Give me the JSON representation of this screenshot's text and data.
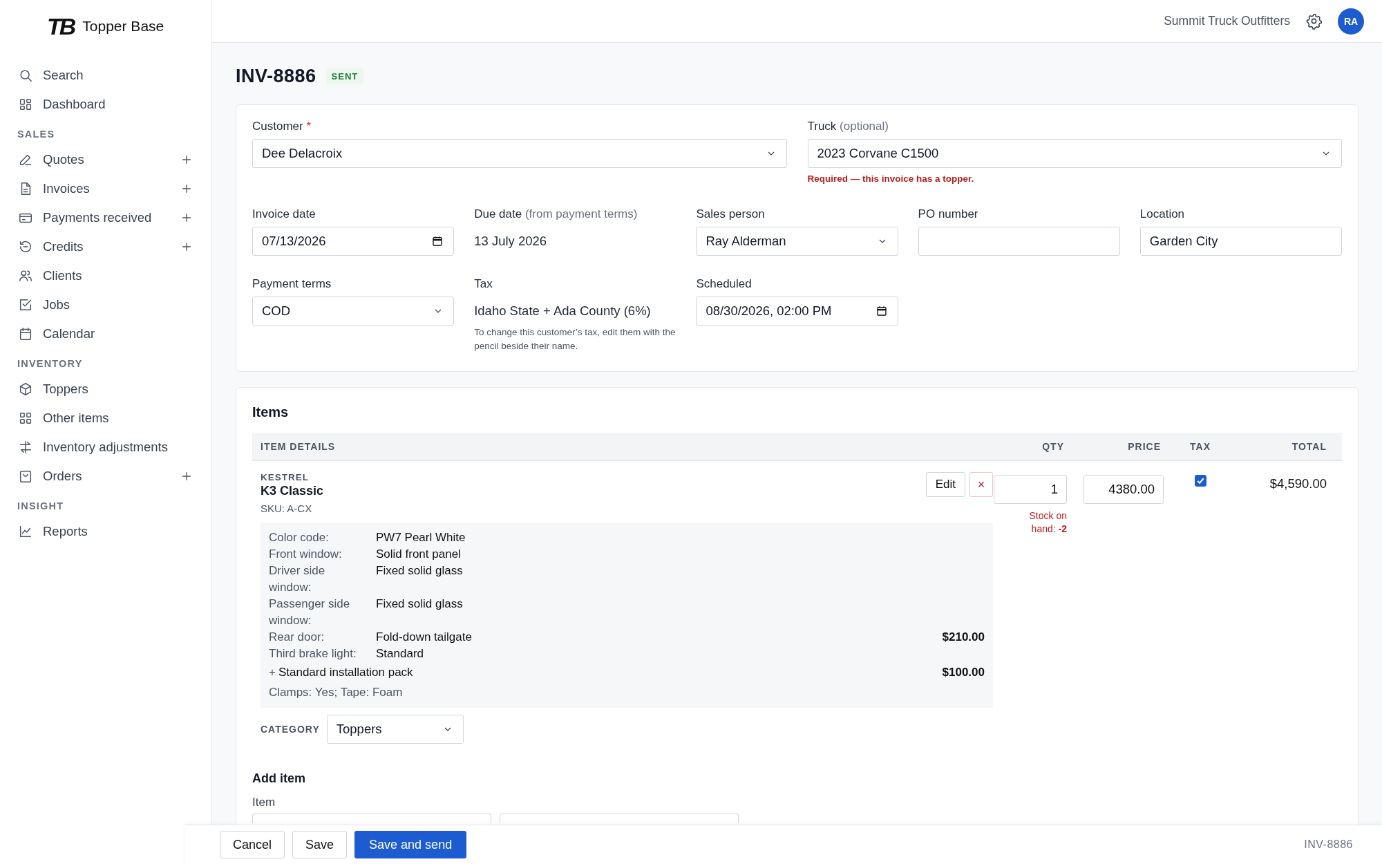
{
  "app": {
    "logo": "TB",
    "name": "Topper Base"
  },
  "sidebar": {
    "items": [
      {
        "kind": "link",
        "label": "Search",
        "add_button": false
      },
      {
        "kind": "link",
        "label": "Dashboard",
        "add_button": false
      },
      {
        "kind": "heading",
        "label": "SALES"
      },
      {
        "kind": "link",
        "label": "Quotes",
        "add_button": true
      },
      {
        "kind": "link",
        "label": "Invoices",
        "add_button": true
      },
      {
        "kind": "link",
        "label": "Payments received",
        "add_button": true
      },
      {
        "kind": "link",
        "label": "Credits",
        "add_button": true
      },
      {
        "kind": "link",
        "label": "Clients",
        "add_button": false
      },
      {
        "kind": "link",
        "label": "Jobs",
        "add_button": false
      },
      {
        "kind": "link",
        "label": "Calendar",
        "add_button": false
      },
      {
        "kind": "heading",
        "label": "INVENTORY"
      },
      {
        "kind": "link",
        "label": "Toppers",
        "add_button": false
      },
      {
        "kind": "link",
        "label": "Other items",
        "add_button": false
      },
      {
        "kind": "link",
        "label": "Inventory adjustments",
        "add_button": false
      },
      {
        "kind": "link",
        "label": "Orders",
        "add_button": true
      },
      {
        "kind": "heading",
        "label": "INSIGHT"
      },
      {
        "kind": "link",
        "label": "Reports",
        "add_button": false
      }
    ]
  },
  "header": {
    "company": "Summit Truck Outfitters",
    "avatar": "RA"
  },
  "invoice": {
    "number": "INV-8886",
    "status": "SENT"
  },
  "form": {
    "rows": [
      {
        "fields": [
          {
            "kind": "select",
            "label": "Customer",
            "required_mark": "*",
            "value": "Dee Delacroix"
          },
          {
            "kind": "select",
            "label": "Truck",
            "hint": "(optional)",
            "value": "2023 Corvane C1500",
            "error": "Required — this invoice has a topper."
          }
        ]
      },
      {
        "fields": [
          {
            "kind": "date",
            "label": "Invoice date",
            "value": "07/13/2026"
          },
          {
            "kind": "static",
            "label": "Due date",
            "hint": "(from payment terms)",
            "value": "13 July 2026"
          },
          {
            "kind": "select",
            "label": "Sales person",
            "value": "Ray Alderman"
          },
          {
            "kind": "text",
            "label": "PO number"
          },
          {
            "kind": "text",
            "label": "Location",
            "value": "Garden City"
          }
        ]
      },
      {
        "fields": [
          {
            "kind": "select",
            "label": "Payment terms",
            "value": "COD"
          },
          {
            "kind": "static",
            "label": "Tax",
            "value": "Idaho State + Ada County (6%)",
            "note": "To change this customer’s tax, edit them with the pencil beside their name."
          },
          {
            "kind": "date",
            "label": "Scheduled",
            "value": "08/30/2026, 02:00 PM"
          }
        ]
      }
    ]
  },
  "items": {
    "title": "Items",
    "columns": [
      "ITEM DETAILS",
      "QTY",
      "PRICE",
      "TAX",
      "TOTAL"
    ],
    "lines": [
      {
        "brand": "KESTREL",
        "name": "K3 Classic",
        "sku": "SKU: A-CX",
        "edit": "Edit",
        "remove": "×",
        "options": [
          {
            "label": "Color code:",
            "value": "PW7 Pearl White"
          },
          {
            "label": "Front window:",
            "value": "Solid front panel"
          },
          {
            "label": "Driver side window:",
            "value": "Fixed solid glass"
          },
          {
            "label": "Passenger side window:",
            "value": "Fixed solid glass"
          },
          {
            "label": "Rear door:",
            "value": "Fold-down tailgate",
            "price": "$210.00"
          },
          {
            "label": "Third brake light:",
            "value": "Standard"
          }
        ],
        "extras": [
          {
            "prefix": "+",
            "name": "Standard installation pack",
            "price": "$100.00"
          }
        ],
        "note": "Clamps: Yes; Tape: Foam",
        "qty": "1",
        "stock": "Stock on hand: **-2**",
        "price": "4380.00",
        "tax": true,
        "total": "$4,590.00",
        "category_label": "CATEGORY",
        "category": "Toppers"
      }
    ],
    "add": {
      "title": "Add item",
      "label": "Item"
    }
  },
  "footer": {
    "buttons": [
      {
        "kind": "secondary",
        "label": "Cancel"
      },
      {
        "kind": "secondary",
        "label": "Save"
      },
      {
        "kind": "primary",
        "label": "Save and send"
      }
    ],
    "reference": "INV-8886"
  }
}
